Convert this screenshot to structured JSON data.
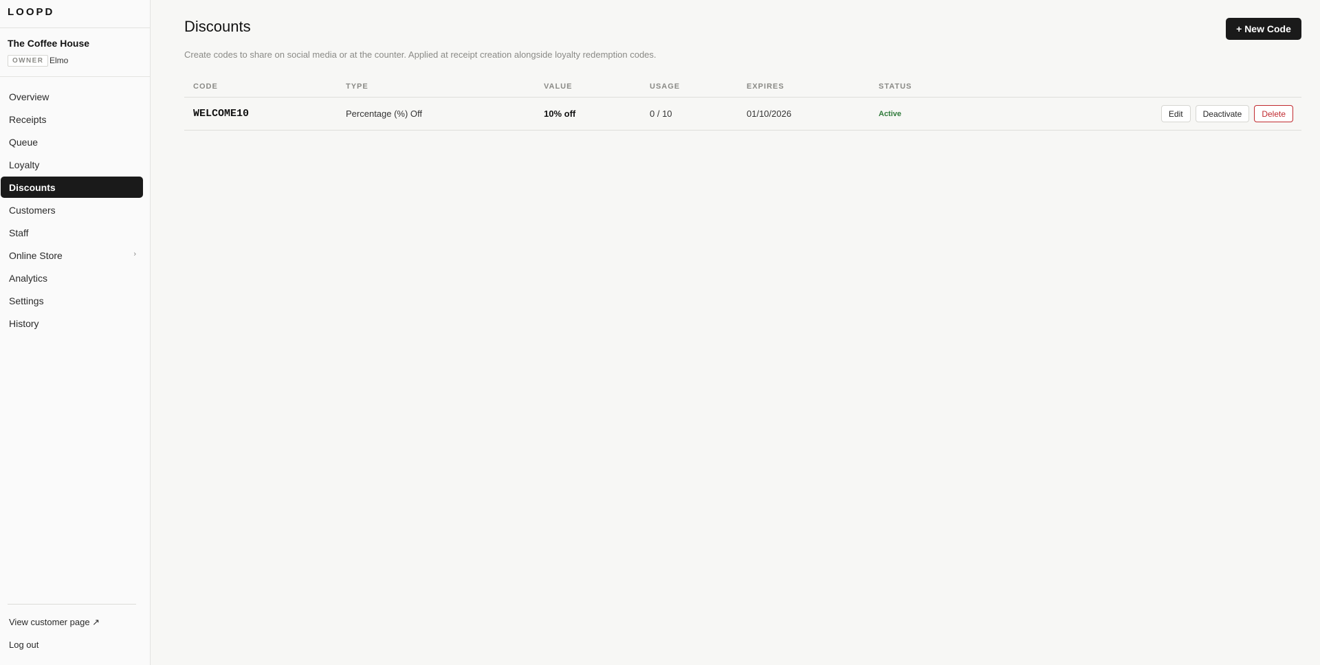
{
  "brand": {
    "logo": "LOOPD"
  },
  "account": {
    "store_name": "The Coffee House",
    "role": "OWNER",
    "user": "Elmo"
  },
  "sidebar": {
    "items": [
      {
        "label": "Overview"
      },
      {
        "label": "Receipts"
      },
      {
        "label": "Queue"
      },
      {
        "label": "Loyalty"
      },
      {
        "label": "Discounts",
        "active": true
      },
      {
        "label": "Customers"
      },
      {
        "label": "Staff"
      },
      {
        "label": "Online Store",
        "has_submenu": true,
        "chevron": "›"
      },
      {
        "label": "Analytics"
      },
      {
        "label": "Settings"
      },
      {
        "label": "History"
      }
    ],
    "footer": {
      "view_customer_page": "View customer page ↗",
      "logout": "Log out"
    }
  },
  "header": {
    "title": "Discounts",
    "subtitle": "Create codes to share on social media or at the counter. Applied at receipt creation alongside loyalty redemption codes.",
    "new_code_button": "+ New Code"
  },
  "table": {
    "columns": [
      "CODE",
      "TYPE",
      "VALUE",
      "USAGE",
      "EXPIRES",
      "STATUS"
    ],
    "rows": [
      {
        "code": "WELCOME10",
        "type": "Percentage (%) Off",
        "value": "10% off",
        "usage": "0 / 10",
        "expires": "01/10/2026",
        "status": "Active",
        "actions": {
          "edit": "Edit",
          "deactivate": "Deactivate",
          "delete": "Delete"
        }
      }
    ]
  },
  "colors": {
    "accent": "#1a1a1a",
    "active_status": "#2f7a3a",
    "danger": "#c0282d",
    "background": "#f7f7f5"
  }
}
